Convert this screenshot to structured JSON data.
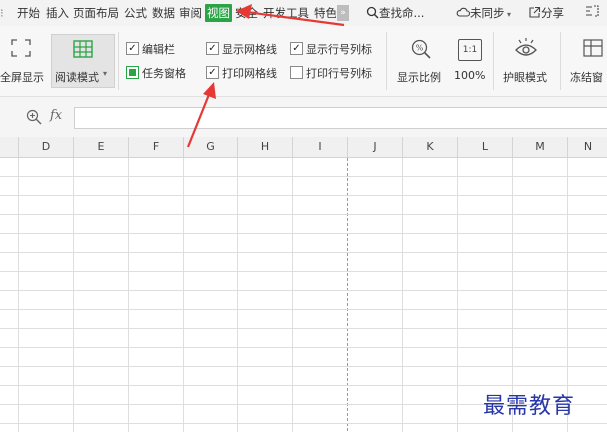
{
  "menu": {
    "items": [
      {
        "label": "开始"
      },
      {
        "label": "插入"
      },
      {
        "label": "页面布局"
      },
      {
        "label": "公式"
      },
      {
        "label": "数据"
      },
      {
        "label": "审阅"
      },
      {
        "label": "视图",
        "active": true
      },
      {
        "label": "安全"
      },
      {
        "label": "开发工具"
      },
      {
        "label": "特色"
      }
    ],
    "more_glyph": "»",
    "search_label": "查找命...",
    "sync_label": "未同步",
    "share_label": "分享",
    "accent_color": "#2aa446"
  },
  "ribbon": {
    "fullscreen_label": "全屏显示",
    "read_mode_label": "阅读模式",
    "checkboxes": [
      {
        "label": "编辑栏",
        "checked": true
      },
      {
        "label": "任务窗格",
        "checked": false,
        "style": "green-square"
      },
      {
        "label": "显示网格线",
        "checked": true
      },
      {
        "label": "打印网格线",
        "checked": true
      },
      {
        "label": "显示行号列标",
        "checked": true
      },
      {
        "label": "打印行号列标",
        "checked": false
      }
    ],
    "zoom_ratio_label": "显示比例",
    "zoom_100_label": "100%",
    "zoom_100_icon_text": "1:1",
    "eye_mode_label": "护眼模式",
    "freeze_label": "冻结窗"
  },
  "formula_bar": {
    "fx_label": "fx",
    "value": ""
  },
  "columns": [
    "D",
    "E",
    "F",
    "G",
    "H",
    "I",
    "J",
    "K",
    "L",
    "M",
    "N"
  ],
  "watermark": "最需教育",
  "annotation_color": "#e53935"
}
